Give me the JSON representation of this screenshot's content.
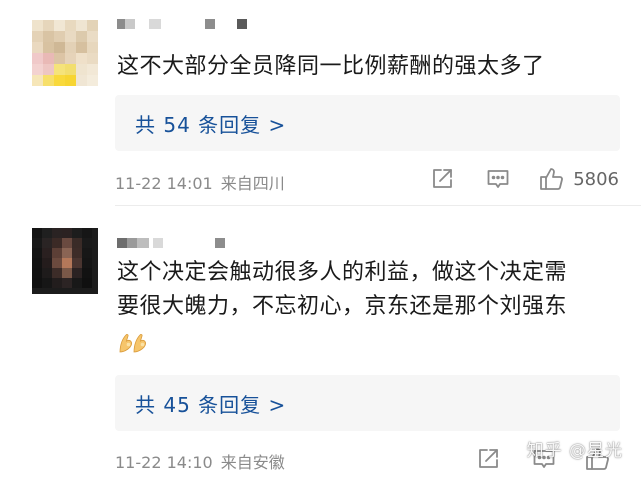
{
  "comments": [
    {
      "text": "这不大部分全员降同一比例薪酬的强太多了",
      "replies_label": "共 54 条回复 >",
      "time": "11-22 14:01",
      "location": "来自四川",
      "likes": "5806",
      "icons": {
        "share": "share-icon",
        "reply": "reply-icon",
        "like": "thumbs-up-icon"
      }
    },
    {
      "text_line1": "这个决定会触动很多人的利益，做这个决定需",
      "text_line2": "要很大魄力，不忘初心，京东还是那个刘强东",
      "emoji": "ok-hand-emoji",
      "replies_label": "共 45 条回复 >",
      "time": "11-22 14:10",
      "location": "来自安徽",
      "icons": {
        "share": "share-icon",
        "reply": "reply-icon",
        "like": "thumbs-up-icon"
      }
    }
  ],
  "watermark": "知乎 @星光",
  "colors": {
    "link": "#175199",
    "meta": "#8a8a8a",
    "text": "#1a1a1a",
    "reply_bg": "#f6f6f6"
  }
}
